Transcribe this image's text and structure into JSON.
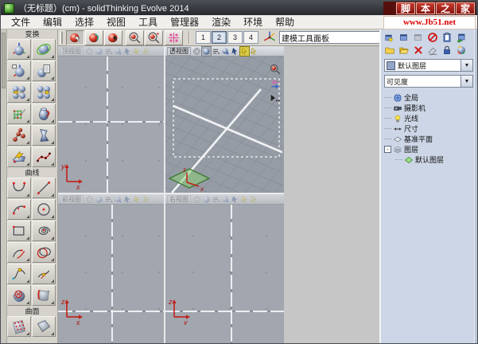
{
  "window": {
    "title": "（无标题）(cm) - solidThinking Evolve 2014"
  },
  "badge": {
    "chars": [
      "脚",
      "本",
      "之",
      "家"
    ],
    "url": "www.Jb51.net"
  },
  "menu": {
    "items": [
      "文件",
      "编辑",
      "选择",
      "视图",
      "工具",
      "管理器",
      "渲染",
      "环境",
      "帮助"
    ]
  },
  "toolbar": {
    "camera_tools": [
      {
        "name": "camera-orbit-icon",
        "active": true
      },
      {
        "name": "camera-pan-icon",
        "active": false
      },
      {
        "name": "camera-dolly-icon",
        "active": false
      }
    ],
    "zoom_tools": [
      {
        "name": "zoom-view-icon",
        "active": false
      },
      {
        "name": "zoom-point-icon",
        "active": false
      }
    ],
    "snap_tool": {
      "name": "snap-grid-icon"
    },
    "layout_buttons": [
      {
        "label": "1",
        "active": false
      },
      {
        "label": "2",
        "active": true
      },
      {
        "label": "3",
        "active": false
      },
      {
        "label": "4",
        "active": false
      }
    ],
    "axis_tool": {
      "name": "world-axes-icon"
    },
    "panel_field": {
      "value": "建模工具面板"
    }
  },
  "palette": {
    "sections": [
      {
        "label": "变换",
        "icons": [
          "translate-tool-icon",
          "rotate-tool-icon",
          "scale-tool-icon",
          "transform-properties-icon",
          "copy-mirror-left-icon",
          "copy-mirror-right-icon",
          "lattice-deform-icon",
          "solid-jug-icon",
          "group-spheres-icon",
          "twist-solid-icon",
          "sweep-surface-icon",
          "edit-curve-points-icon"
        ]
      },
      {
        "label": "曲线",
        "icons": [
          "sketch-curve-icon",
          "line-tool-icon",
          "arc-tool-icon",
          "circle-tool-icon",
          "rectangle-tool-icon",
          "spiral-tool-icon",
          "blend-arcs-icon",
          "ellipse-tool-icon",
          "curve-handle-icon",
          "tangent-curve-icon",
          "project-curve-icon",
          "extract-edge-icon"
        ]
      },
      {
        "label": "曲面",
        "icons": [
          "control-point-surface-icon",
          "surface-patch-icon"
        ]
      }
    ]
  },
  "viewports": {
    "top_left": {
      "label": "顶视图",
      "axis_up": "y",
      "axis_right": "x"
    },
    "perspective": {
      "label": "透视图"
    },
    "bottom_left": {
      "label": "前视图",
      "axis_up": "z",
      "axis_right": "x"
    },
    "bottom_right": {
      "label": "右视图",
      "axis_up": "z",
      "axis_right": "y"
    },
    "persp_plane_axis": {
      "up": "z",
      "right": "x"
    }
  },
  "right_panel": {
    "toolbar_row1": [
      "new-window-icon",
      "duplicate-window-icon",
      "inactive-window-icon",
      "forbid-icon",
      "clipboard-icon",
      "import-window-icon"
    ],
    "toolbar_row2": [
      "folder-icon",
      "folder-open-icon",
      "delete-icon",
      "eraser-icon",
      "lock-icon",
      "material-sphere-icon"
    ],
    "layer_combo": {
      "value": "默认图层"
    },
    "visibility_combo": {
      "value": "可见度"
    },
    "tree": [
      {
        "label": "全局",
        "icon": "globe-icon",
        "depth": 1
      },
      {
        "label": "摄影机",
        "icon": "camera-icon",
        "depth": 1
      },
      {
        "label": "光线",
        "icon": "light-icon",
        "depth": 1
      },
      {
        "label": "尺寸",
        "icon": "dimension-icon",
        "depth": 1
      },
      {
        "label": "基准平面",
        "icon": "plane-icon",
        "depth": 1
      },
      {
        "label": "图层",
        "icon": "layers-icon",
        "depth": 1,
        "expander": "-"
      },
      {
        "label": "默认图层",
        "icon": "layer-green-icon",
        "depth": 2
      }
    ]
  }
}
